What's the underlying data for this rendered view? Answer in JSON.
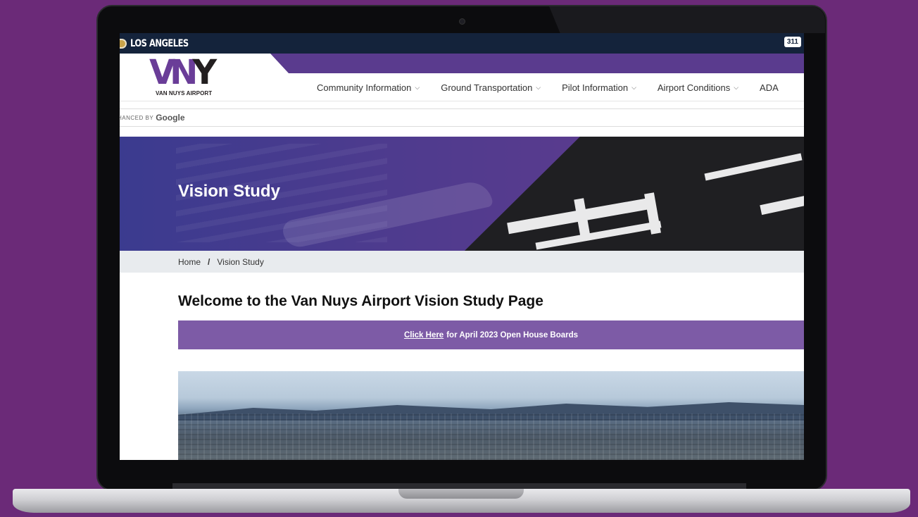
{
  "topbar": {
    "city_label": "LOS ANGELES",
    "service_badge": "311"
  },
  "header": {
    "logo_caption": "VAN NUYS AIRPORT",
    "nav_items": [
      {
        "label": "Community Information"
      },
      {
        "label": "Ground Transportation"
      },
      {
        "label": "Pilot Information"
      },
      {
        "label": "Airport Conditions"
      },
      {
        "label": "ADA"
      }
    ]
  },
  "search": {
    "enhanced_label": "HANCED BY",
    "provider": "Google"
  },
  "hero": {
    "title": "Vision Study"
  },
  "breadcrumb": {
    "items": [
      "Home",
      "Vision Study"
    ],
    "separator": "/"
  },
  "main": {
    "heading": "Welcome to the Van Nuys Airport Vision Study Page",
    "cta": {
      "link_text": "Click Here",
      "rest_text": "for April 2023 Open House Boards"
    }
  },
  "colors": {
    "brand_purple": "#5a3b8e",
    "cta_purple": "#7d5ba6",
    "topbar_navy": "#14233b",
    "background": "#6b2a78"
  }
}
